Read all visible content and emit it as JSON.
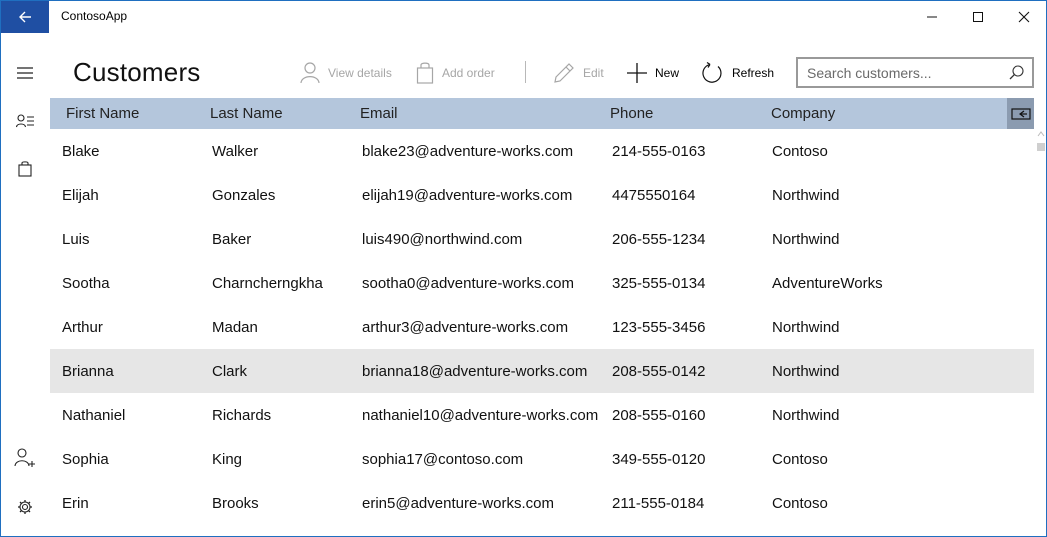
{
  "window": {
    "title": "ContosoApp"
  },
  "page": {
    "title": "Customers"
  },
  "toolbar": {
    "view_details": "View details",
    "add_order": "Add order",
    "edit": "Edit",
    "new": "New",
    "refresh": "Refresh"
  },
  "search": {
    "placeholder": "Search customers...",
    "value": ""
  },
  "grid": {
    "columns": [
      "First Name",
      "Last Name",
      "Email",
      "Phone",
      "Company"
    ],
    "selected_row_index": 5,
    "rows": [
      [
        "Blake",
        "Walker",
        "blake23@adventure-works.com",
        "214-555-0163",
        "Contoso"
      ],
      [
        "Elijah",
        "Gonzales",
        "elijah19@adventure-works.com",
        "4475550164",
        "Northwind"
      ],
      [
        "Luis",
        "Baker",
        "luis490@northwind.com",
        "206-555-1234",
        "Northwind"
      ],
      [
        "Sootha",
        "Charncherngkha",
        "sootha0@adventure-works.com",
        "325-555-0134",
        "AdventureWorks"
      ],
      [
        "Arthur",
        "Madan",
        "arthur3@adventure-works.com",
        "123-555-3456",
        "Northwind"
      ],
      [
        "Brianna",
        "Clark",
        "brianna18@adventure-works.com",
        "208-555-0142",
        "Northwind"
      ],
      [
        "Nathaniel",
        "Richards",
        "nathaniel10@adventure-works.com",
        "208-555-0160",
        "Northwind"
      ],
      [
        "Sophia",
        "King",
        "sophia17@contoso.com",
        "349-555-0120",
        "Contoso"
      ],
      [
        "Erin",
        "Brooks",
        "erin5@adventure-works.com",
        "211-555-0184",
        "Contoso"
      ]
    ]
  },
  "nav": {
    "items": [
      "hamburger-menu-icon",
      "customer-list-icon",
      "orders-bag-icon",
      "add-user-icon",
      "settings-gear-icon"
    ]
  },
  "colors": {
    "back_button": "#1f4fa3",
    "header_row": "#b4c6dc",
    "header_toggle": "#8b9bb0",
    "selected_row": "#e6e6e6",
    "disabled_text": "#a6a6a6"
  }
}
